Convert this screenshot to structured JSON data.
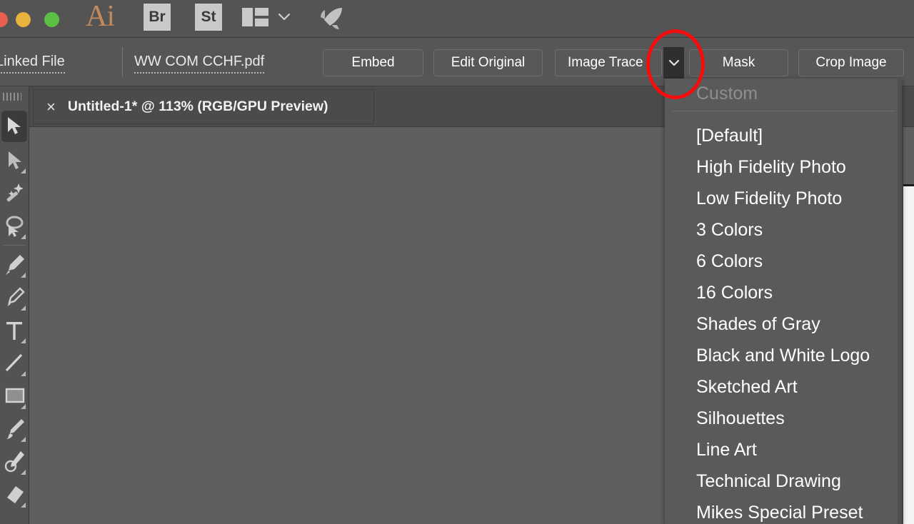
{
  "window": {
    "traffic_lights": [
      "close",
      "minimize",
      "maximize"
    ],
    "app_logo": "Ai",
    "app_chips": [
      {
        "label": "Br",
        "name": "bridge"
      },
      {
        "label": "St",
        "name": "stock"
      }
    ],
    "arrange_icon": "arrange-documents-icon",
    "arrange_caret": "chevron-down-icon",
    "rocket_icon": "rocket-icon"
  },
  "control_bar": {
    "link_status": "Linked File",
    "file_name": "WW COM CCHF.pdf",
    "buttons": [
      {
        "label": "Embed",
        "name": "embed-button"
      },
      {
        "label": "Edit Original",
        "name": "edit-original-button"
      },
      {
        "label": "Image Trace",
        "name": "image-trace-button"
      },
      {
        "label": "Mask",
        "name": "mask-button"
      },
      {
        "label": "Crop Image",
        "name": "crop-image-button"
      }
    ],
    "trace_caret": "chevron-down-icon",
    "annotation_color": "#f50d0d"
  },
  "document_tab": {
    "close_glyph": "×",
    "title": "Untitled-1* @ 113% (RGB/GPU Preview)",
    "zoom_level": "113%",
    "color_mode": "RGB/GPU Preview",
    "file_name": "Untitled-1*"
  },
  "tools": [
    {
      "name": "selection-tool",
      "active": true
    },
    {
      "name": "direct-selection-tool",
      "active": false
    },
    {
      "name": "magic-wand-tool",
      "active": false
    },
    {
      "name": "lasso-tool",
      "active": false
    },
    {
      "name": "pen-tool",
      "active": false
    },
    {
      "name": "add-anchor-point-tool",
      "active": false
    },
    {
      "name": "type-tool",
      "active": false
    },
    {
      "name": "line-segment-tool",
      "active": false
    },
    {
      "name": "rectangle-tool",
      "active": false
    },
    {
      "name": "paintbrush-tool",
      "active": false
    },
    {
      "name": "pencil-tool",
      "active": false
    },
    {
      "name": "eraser-tool",
      "active": false
    }
  ],
  "trace_preset_menu": {
    "header": "Custom",
    "items": [
      "[Default]",
      "High Fidelity Photo",
      "Low Fidelity Photo",
      "3 Colors",
      "6 Colors",
      "16 Colors",
      "Shades of Gray",
      "Black and White Logo",
      "Sketched Art",
      "Silhouettes",
      "Line Art",
      "Technical Drawing",
      "Mikes Special Preset"
    ]
  },
  "colors": {
    "chrome": "#545454",
    "control_bar": "#565656",
    "canvas": "#5f5f5f",
    "menu_bg": "#5a5a5a",
    "accent_logo": "#c08a5e",
    "annotation": "#f50d0d"
  }
}
